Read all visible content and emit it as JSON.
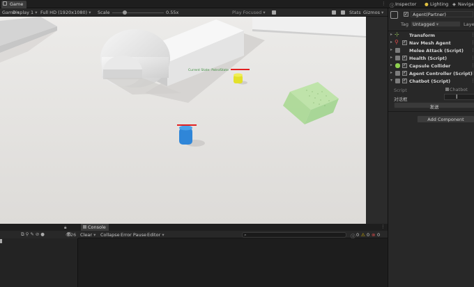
{
  "game_panel": {
    "tab_label": "Game",
    "toolbar": {
      "mode": "Game",
      "display": "Display 1",
      "resolution": "Full HD (1920x1080)",
      "scale_label": "Scale",
      "scale_value": "0.55x",
      "play_mode": "Play Focused",
      "stats": "Stats",
      "gizmos": "Gizmos"
    },
    "scene": {
      "agent_status_text": "Current State: PatrolState"
    }
  },
  "inspector": {
    "tabs": [
      "Inspector",
      "Lighting",
      "Navigat"
    ],
    "object_name": "Agent(Partner)",
    "tag_label": "Tag",
    "tag_value": "Untagged",
    "layer_label": "Laye",
    "components": [
      {
        "name": "Transform",
        "icon": "transform-icon",
        "has_checkbox": false
      },
      {
        "name": "Nav Mesh Agent",
        "icon": "navmesh-icon",
        "has_checkbox": true
      },
      {
        "name": "Melee Attack (Script)",
        "icon": "script-icon",
        "has_checkbox": true
      },
      {
        "name": "Health (Script)",
        "icon": "script-icon",
        "has_checkbox": true
      },
      {
        "name": "Capsule Collider",
        "icon": "collider-icon",
        "has_checkbox": true
      },
      {
        "name": "Agent Controller (Script)",
        "icon": "script-icon",
        "has_checkbox": true
      },
      {
        "name": "Chatbot (Script)",
        "icon": "script-icon",
        "has_checkbox": true
      }
    ],
    "chatbot": {
      "script_label": "Script",
      "script_value": "Chatbot",
      "field_label": "对话框",
      "send_button": "发送"
    },
    "add_component": "Add Component"
  },
  "console": {
    "tab_label": "Console",
    "toolbar": {
      "count_left": "26",
      "clear": "Clear",
      "collapse": "Collapse",
      "error_pause": "Error Pause",
      "editor": "Editor",
      "log_count": "0",
      "warn_count": "0",
      "error_count": "0"
    }
  },
  "colors": {
    "viewport_ground": "#e5e3e1",
    "agent_blue": "#2f86d8",
    "enemy_yellow": "#e3e12a",
    "zone_green": "#a8dc8e",
    "health_bar": "#e12020"
  }
}
